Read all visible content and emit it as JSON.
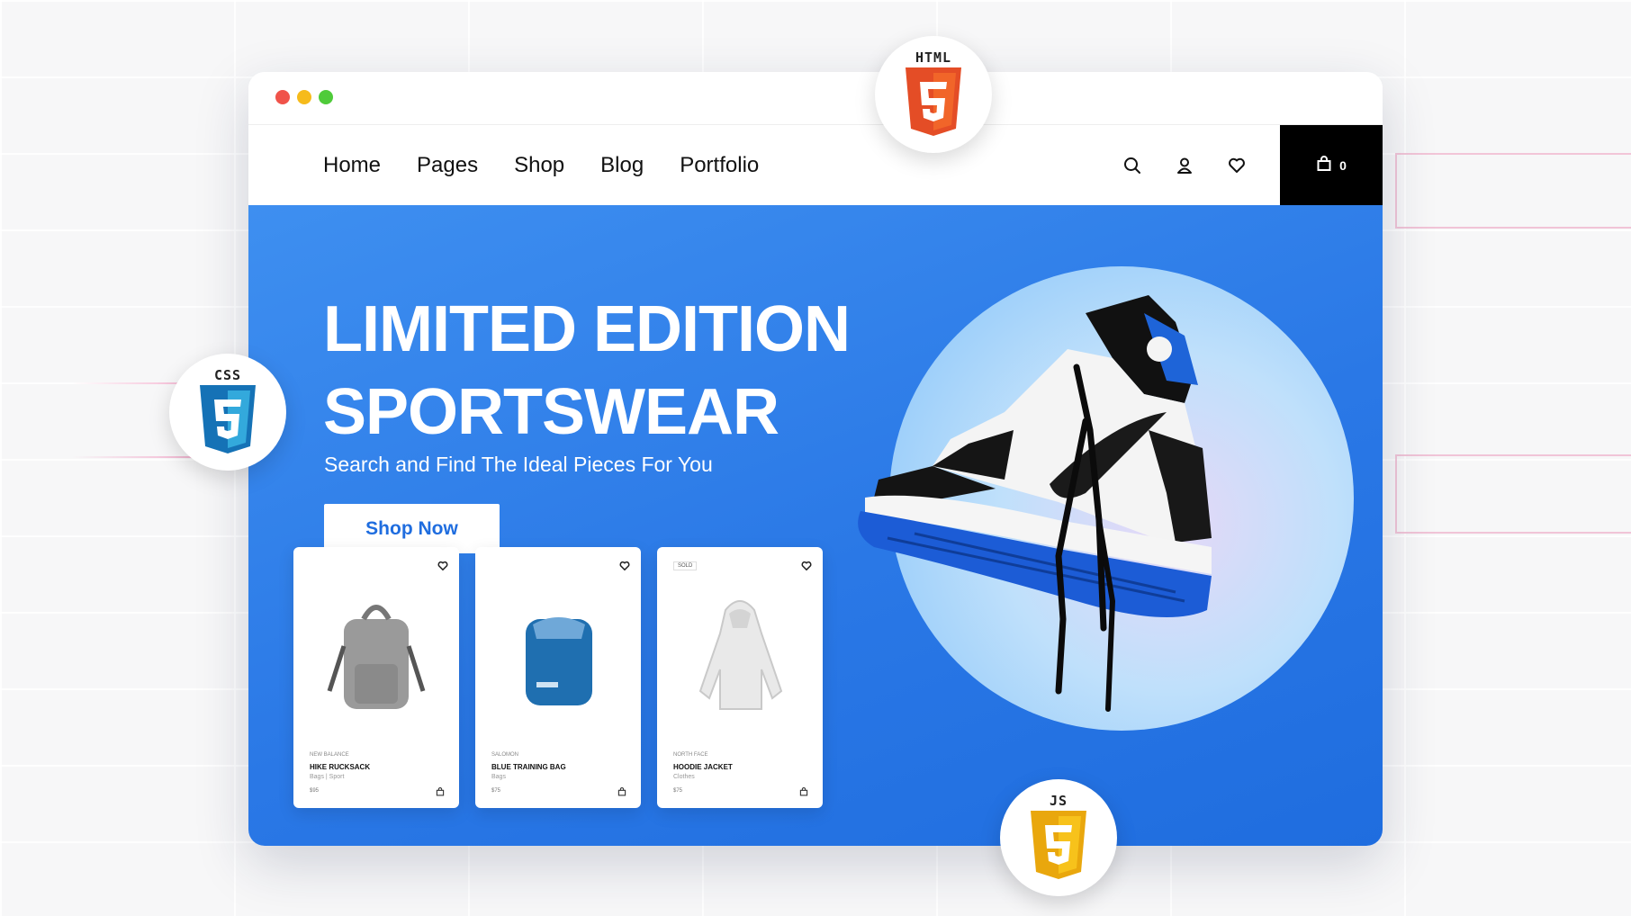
{
  "nav": {
    "links": [
      "Home",
      "Pages",
      "Shop",
      "Blog",
      "Portfolio"
    ],
    "cart_count": "0"
  },
  "hero": {
    "title_line1": "LIMITED EDITION",
    "title_line2": "SPORTSWEAR",
    "subtitle": "Search and Find The Ideal Pieces For You",
    "cta_label": "Shop Now"
  },
  "products": [
    {
      "brand": "NEW BALANCE",
      "name": "HIKE RUCKSACK",
      "category": "Bags  |  Sport",
      "price": "$95",
      "badge": ""
    },
    {
      "brand": "SALOMON",
      "name": "BLUE TRAINING BAG",
      "category": "Bags",
      "price": "$75",
      "badge": ""
    },
    {
      "brand": "NORTH FACE",
      "name": "HOODIE JACKET",
      "category": "Clothes",
      "price": "$75",
      "badge": "SOLD"
    }
  ],
  "tech_badges": {
    "html": "HTML",
    "css": "CSS",
    "js": "JS"
  },
  "colors": {
    "hero_blue": "#2a78e6",
    "html_orange": "#e44d26",
    "css_blue": "#1572b6",
    "js_yellow": "#f0a90f",
    "cart_black": "#000000"
  }
}
